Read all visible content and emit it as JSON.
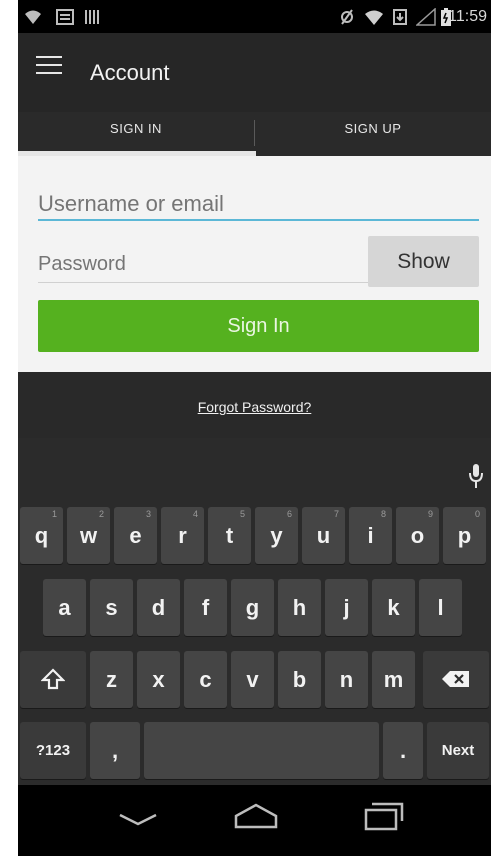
{
  "status_bar": {
    "time": "11:59",
    "icons": [
      "wifi-icon",
      "gallery-icon",
      "barcode-icon",
      "no-sync-icon",
      "wifi-signal-icon",
      "download-icon",
      "cell-signal-icon",
      "battery-icon"
    ]
  },
  "action_bar": {
    "title": "Account",
    "menu_icon": "hamburger-menu-icon"
  },
  "tabs": [
    {
      "label": "SIGN IN",
      "selected": true
    },
    {
      "label": "SIGN UP",
      "selected": false
    }
  ],
  "form": {
    "username_placeholder": "Username or email",
    "password_placeholder": "Password",
    "show_label": "Show",
    "signin_label": "Sign In"
  },
  "forgot_label": "Forgot Password?",
  "keyboard": {
    "row1": [
      {
        "k": "q",
        "h": "1"
      },
      {
        "k": "w",
        "h": "2"
      },
      {
        "k": "e",
        "h": "3"
      },
      {
        "k": "r",
        "h": "4"
      },
      {
        "k": "t",
        "h": "5"
      },
      {
        "k": "y",
        "h": "6"
      },
      {
        "k": "u",
        "h": "7"
      },
      {
        "k": "i",
        "h": "8"
      },
      {
        "k": "o",
        "h": "9"
      },
      {
        "k": "p",
        "h": "0"
      }
    ],
    "row2": [
      "a",
      "s",
      "d",
      "f",
      "g",
      "h",
      "j",
      "k",
      "l"
    ],
    "row3": [
      "z",
      "x",
      "c",
      "v",
      "b",
      "n",
      "m"
    ],
    "symbols_label": "?123",
    "comma": ",",
    "period": ".",
    "next_label": "Next"
  },
  "colors": {
    "accent": "#55b11f",
    "focus_line": "#5bb7d6"
  }
}
